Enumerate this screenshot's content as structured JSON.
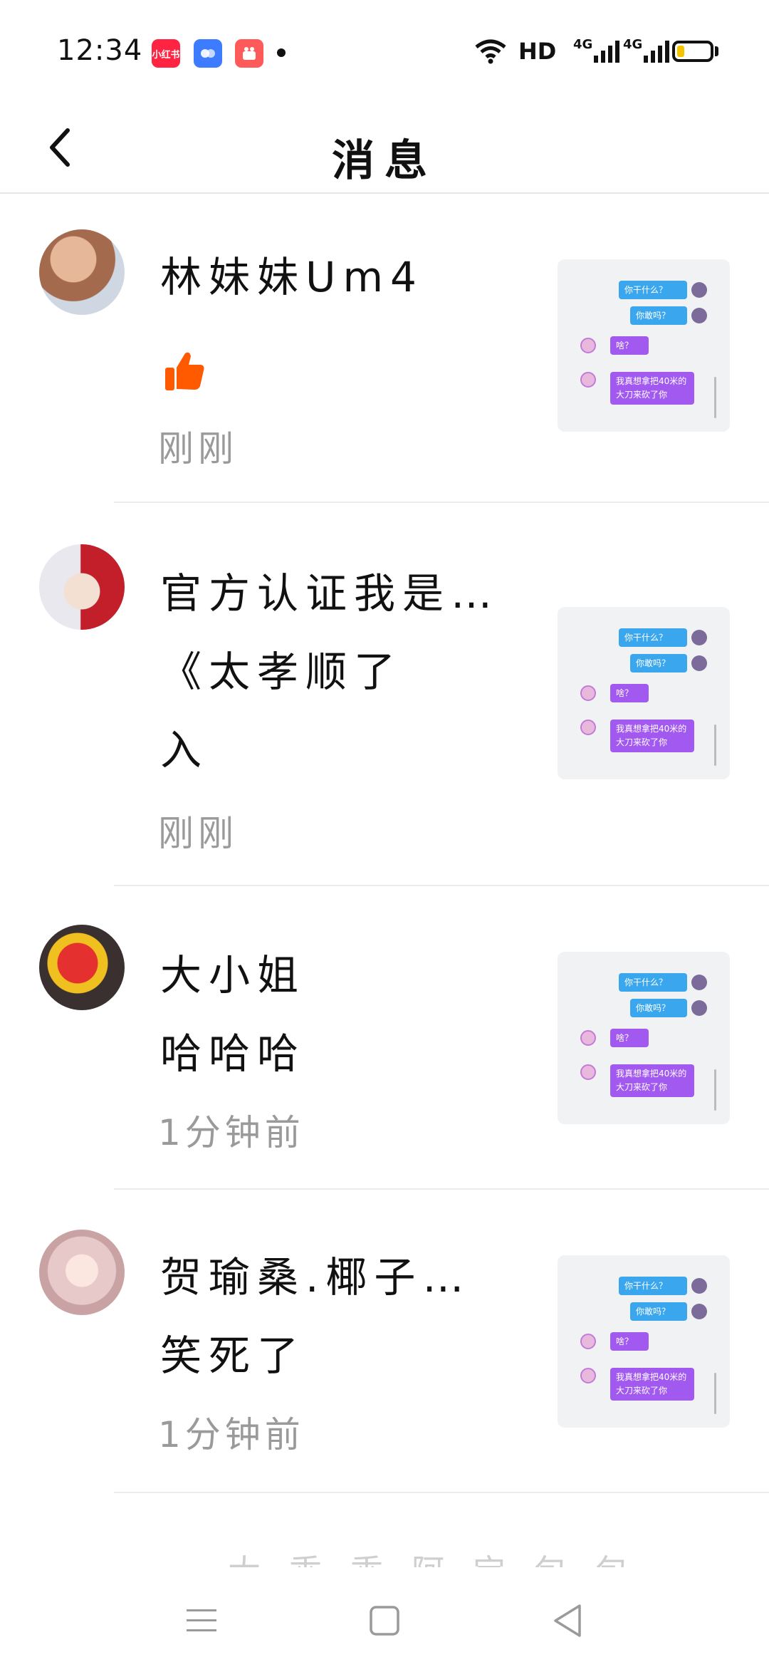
{
  "status_bar": {
    "time": "12:34",
    "app_badges": [
      "小红书",
      "",
      ""
    ],
    "network": "HD",
    "signal_1": "4G",
    "signal_2": "4G",
    "battery_color": "#f5c400"
  },
  "header": {
    "title": "消息",
    "back_icon": "chevron-left-icon"
  },
  "messages": [
    {
      "name": "林妹妹Um4",
      "message": "",
      "message_icon": "thumbs-up-icon",
      "time": "刚刚"
    },
    {
      "name": "官方认证我是…",
      "message": "《太孝顺了",
      "message2": "入",
      "time": "刚刚"
    },
    {
      "name": "大小姐",
      "message": "哈哈哈",
      "time": "1分钟前"
    },
    {
      "name": "贺瑜桑.椰子…",
      "message": "笑死了",
      "time": "1分钟前"
    }
  ],
  "thumbnail_chat": {
    "bubble1": "你干什么？",
    "bubble2": "你敢吗？",
    "bubble3": "啥？",
    "bubble4": "我真想拿把40米的大刀来砍了你"
  },
  "partial_item_text": "大乖乖阿宝包包",
  "accent_colors": {
    "like": "#ff5a00",
    "bubble_blue": "#3aa6ee",
    "bubble_purple": "#a259f0"
  }
}
